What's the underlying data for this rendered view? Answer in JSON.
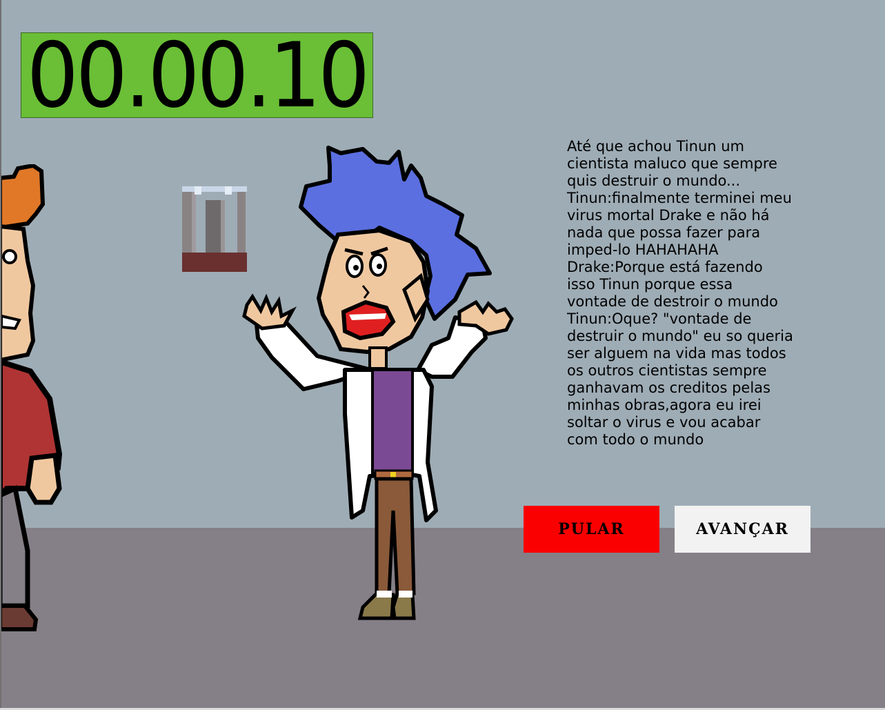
{
  "hud": {
    "timer": "00.00.10"
  },
  "dialogue": {
    "text": "Até que achou Tinun um\ncientista maluco que sempre\nquis destruir o mundo...\nTinun:finalmente terminei meu\nvirus mortal Drake e não há\nnada que possa fazer para\nimped-lo HAHAHAHA\nDrake:Porque está fazendo\nisso Tinun porque essa\nvontade de destroir o mundo\nTinun:Oque? \"vontade de\ndestruir o mundo\" eu so queria\nser alguem na vida mas todos\nos outros cientistas sempre\nganhavam os creditos pelas\nminhas obras,agora eu irei\nsoltar o virus e vou acabar\ncom todo o mundo"
  },
  "buttons": {
    "skip_label": "PULAR",
    "next_label": "AVANÇAR"
  },
  "colors": {
    "wall": "#9eacb5",
    "floor": "#857f87",
    "timer_bg": "#6abf36",
    "skip_bg": "#fb0000",
    "next_bg": "#f2f2f2",
    "tinun_hair": "#5b6fe0",
    "tinun_skin": "#f0c8a0",
    "tinun_shirt": "#7b4a94",
    "drake_hair": "#e07828",
    "drake_shirt": "#b03434"
  },
  "characters": {
    "left": "drake-sprite",
    "center": "tinun-sprite"
  }
}
